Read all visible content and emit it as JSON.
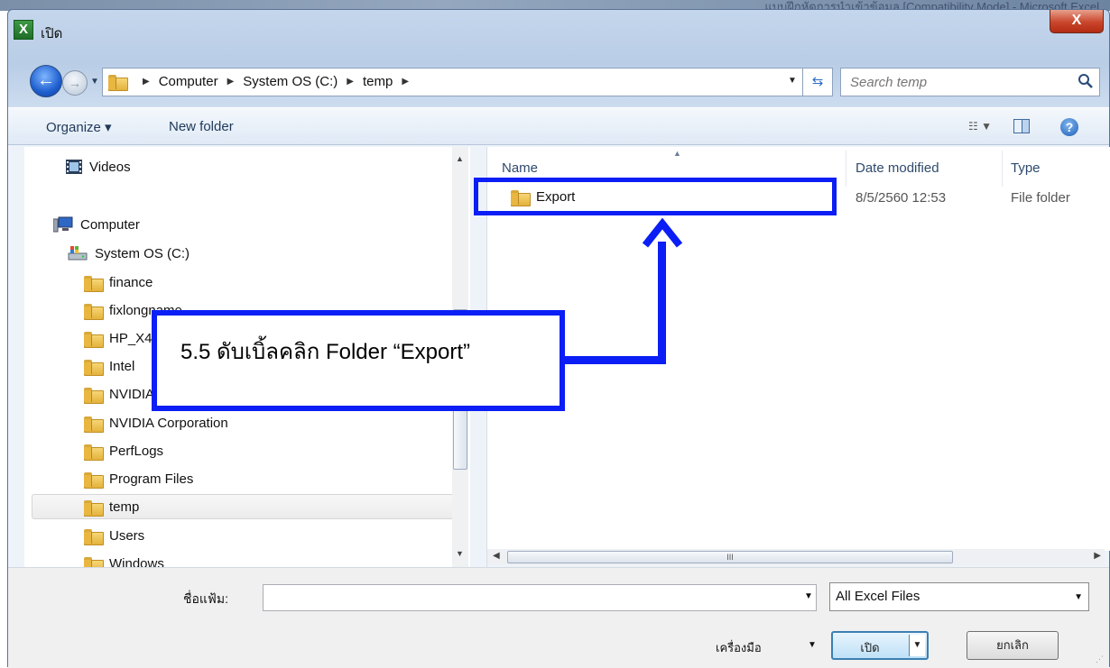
{
  "background": {
    "title_text": "แบบฝึกหัดการนำเข้าข้อมูล [Compatibility Mode] - Microsoft Excel"
  },
  "dialog": {
    "title": "เปิด",
    "close_label": "X"
  },
  "nav": {
    "breadcrumbs": [
      "Computer",
      "System OS (C:)",
      "temp"
    ],
    "search_placeholder": "Search temp"
  },
  "toolbar": {
    "organize_label": "Organize ▾",
    "new_folder_label": "New folder"
  },
  "tree": {
    "videos": "Videos",
    "computer": "Computer",
    "drive": "System OS (C:)",
    "folders": [
      "finance",
      "fixlongname",
      "HP_X47",
      "Intel",
      "NVIDIA",
      "NVIDIA Corporation",
      "PerfLogs",
      "Program Files",
      "temp",
      "Users",
      "Windows"
    ],
    "selected": "temp"
  },
  "columns": {
    "name": "Name",
    "date": "Date modified",
    "type": "Type"
  },
  "files": [
    {
      "name": "Export",
      "date": "8/5/2560 12:53",
      "type": "File folder"
    }
  ],
  "bottom": {
    "filename_label": "ชื่อแฟ้ม:",
    "filename_value": "",
    "filter_value": "All Excel Files",
    "tools_label": "เครื่องมือ",
    "open_label": "เปิด",
    "cancel_label": "ยกเลิก"
  },
  "annotation": {
    "text": "5.5 ดับเบิ้ลคลิก Folder “Export”",
    "color": "#0a1ef5"
  }
}
